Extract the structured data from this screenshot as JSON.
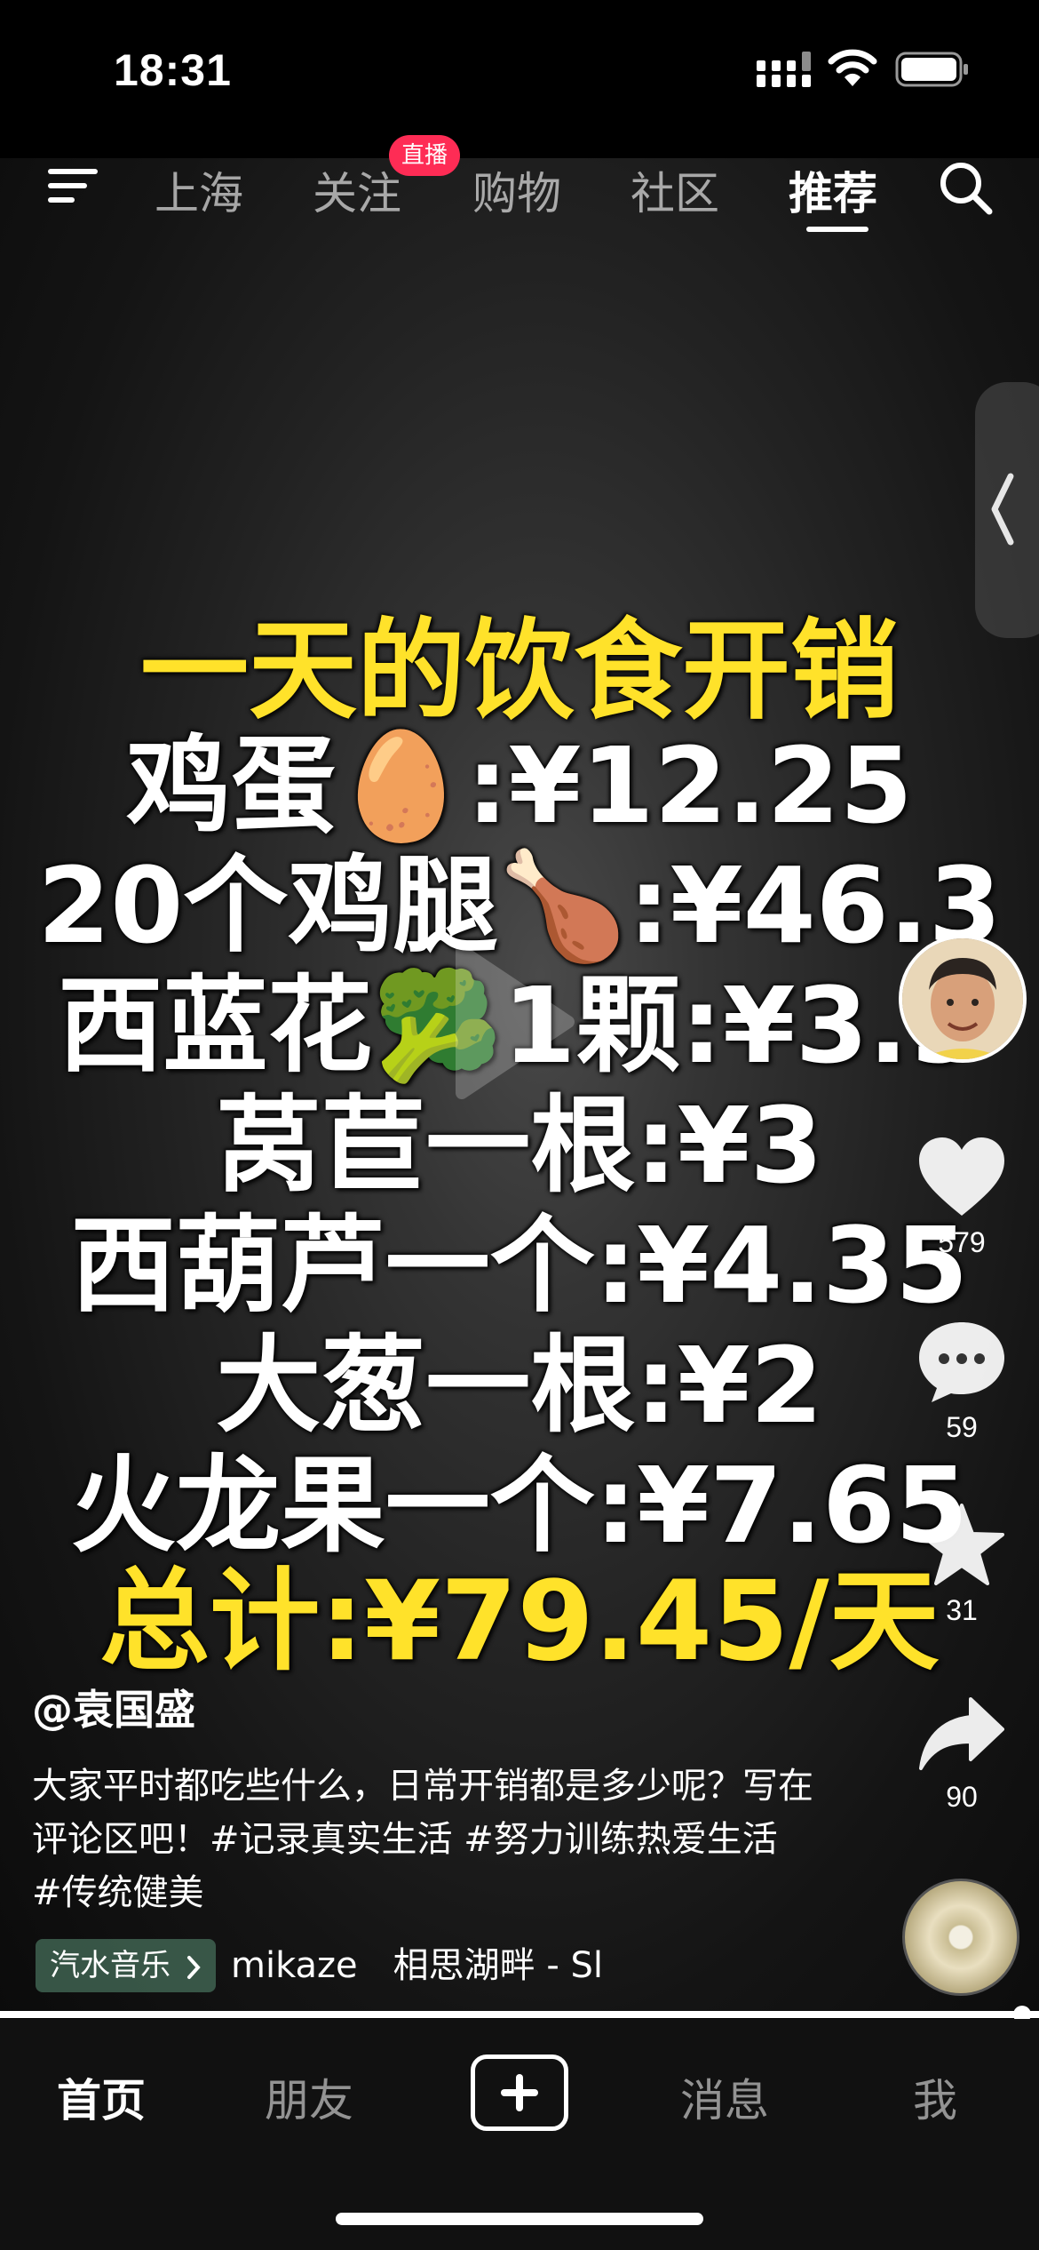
{
  "status_bar": {
    "time": "18:31"
  },
  "top_nav": {
    "tabs": [
      {
        "label": "上海",
        "active": false
      },
      {
        "label": "关注",
        "active": false
      },
      {
        "label": "购物",
        "active": false
      },
      {
        "label": "社区",
        "active": false
      },
      {
        "label": "推荐",
        "active": true
      }
    ],
    "live_badge": "直播"
  },
  "video": {
    "lines": [
      "一天的饮食开销",
      "鸡蛋🥚:¥12.25",
      "20个鸡腿🍗:¥46.3",
      "西蓝花🥦1颗:¥3.9",
      "莴苣一根:¥3",
      "西葫芦一个:¥4.35",
      "大葱一根:¥2",
      "火龙果一个:¥7.65",
      "总计:¥79.45/天"
    ],
    "highlight_color": "#ffe22a"
  },
  "actions": {
    "likes": "579",
    "comments": "59",
    "favorites": "31",
    "shares": "90"
  },
  "post": {
    "author": "@袁国盛",
    "caption": "大家平时都吃些什么，日常开销都是多少呢？写在评论区吧！#记录真实生活 #努力训练热爱生活 #传统健美",
    "music_chip": "汽水音乐",
    "music_text": "mikaze　相思湖畔 - Sl"
  },
  "bottom_tabs": {
    "home": "首页",
    "friends": "朋友",
    "messages": "消息",
    "me": "我"
  },
  "colors": {
    "accent": "#fe2c55",
    "text_yellow": "#ffe22a"
  },
  "icons": [
    "menu-icon",
    "search-icon",
    "heart-icon",
    "comment-icon",
    "star-icon",
    "share-icon",
    "plus-icon",
    "signal-icon",
    "wifi-icon",
    "battery-icon"
  ]
}
